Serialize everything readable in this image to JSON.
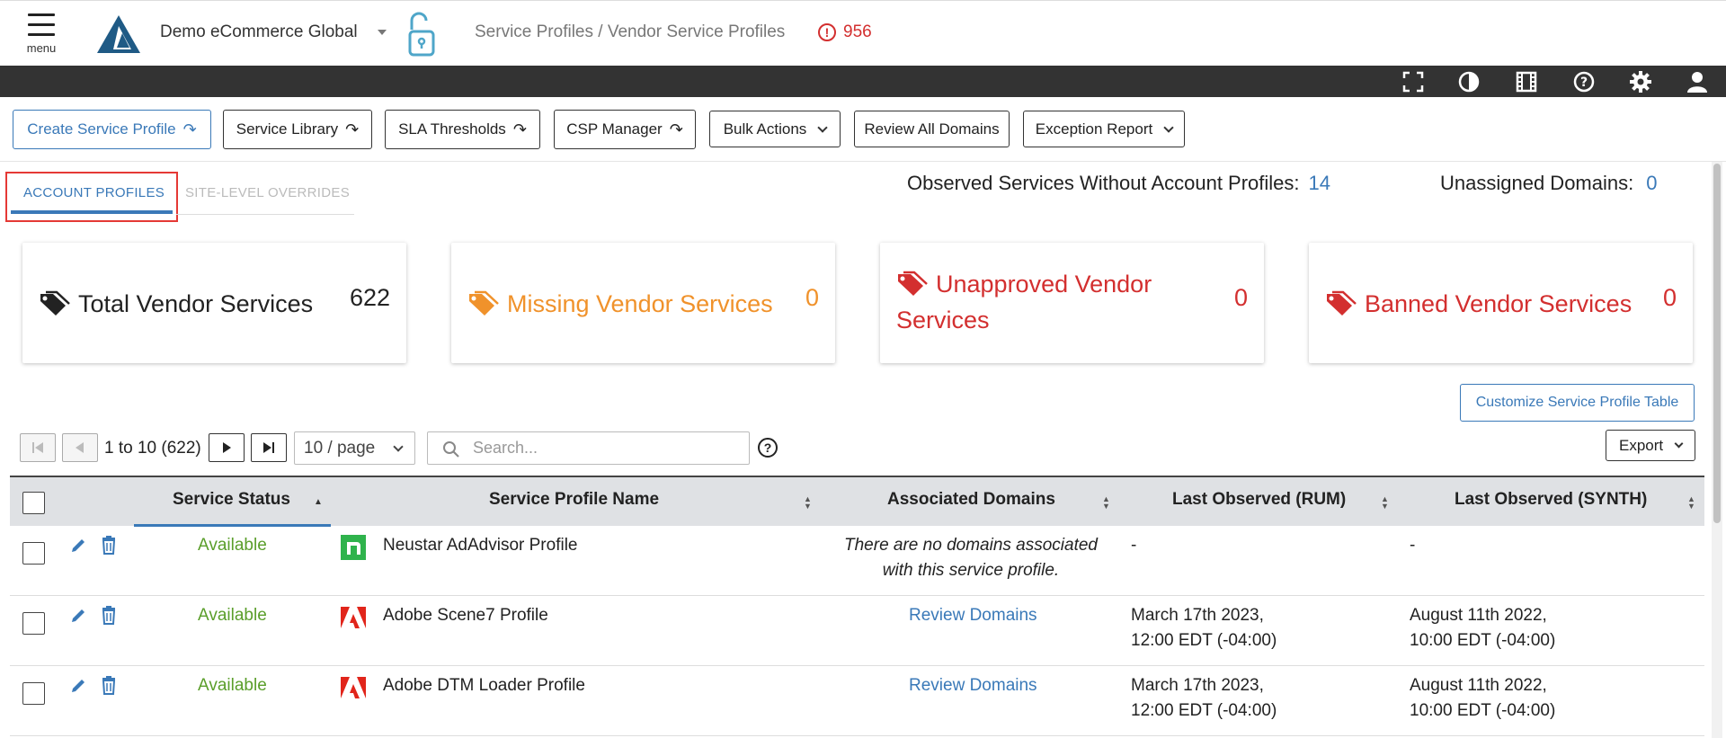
{
  "header": {
    "menu_label": "menu",
    "org_name": "Demo eCommerce Global",
    "breadcrumb": "Service Profiles / Vendor Service Profiles",
    "alert_count": "956"
  },
  "toolbar": {
    "create_service_profile": "Create Service Profile",
    "service_library": "Service Library",
    "sla_thresholds": "SLA Thresholds",
    "csp_manager": "CSP Manager",
    "bulk_actions": "Bulk Actions",
    "review_all_domains": "Review All Domains",
    "exception_report": "Exception Report"
  },
  "tabs": {
    "account_profiles": "ACCOUNT PROFILES",
    "site_level_overrides": "SITE-LEVEL OVERRIDES"
  },
  "summary": {
    "observed_label": "Observed Services Without Account Profiles:",
    "observed_value": "14",
    "unassigned_label": "Unassigned Domains:",
    "unassigned_value": "0"
  },
  "cards": {
    "total": {
      "label": "Total Vendor Services",
      "value": "622",
      "color": "#222222"
    },
    "missing": {
      "label": "Missing Vendor Services",
      "value": "0",
      "color": "#f0922b"
    },
    "unapproved_line1": "Unapproved Vendor",
    "unapproved_line2": "Services",
    "unapproved_value": "0",
    "unapproved_color": "#d32f2f",
    "banned": {
      "label": "Banned Vendor Services",
      "value": "0",
      "color": "#d32f2f"
    }
  },
  "customize_button": "Customize Service Profile Table",
  "pager": {
    "range_text": "1 to 10 (622)",
    "per_page": "10 / page",
    "search_placeholder": "Search...",
    "export_label": "Export"
  },
  "table": {
    "columns": {
      "status": "Service Status",
      "name": "Service Profile Name",
      "domains": "Associated Domains",
      "rum": "Last Observed (RUM)",
      "synth": "Last Observed (SYNTH)"
    },
    "rows": [
      {
        "status": "Available",
        "name": "Neustar AdAdvisor Profile",
        "logo": "neustar-logo",
        "domains_line1": "There are no domains associated",
        "domains_line2": "with this service profile.",
        "rum_line1": "-",
        "rum_line2": "",
        "synth_line1": "-",
        "synth_line2": ""
      },
      {
        "status": "Available",
        "name": "Adobe Scene7 Profile",
        "logo": "adobe-logo",
        "domains_link": "Review Domains",
        "rum_line1": "March 17th 2023,",
        "rum_line2": "12:00 EDT (-04:00)",
        "synth_line1": "August 11th 2022,",
        "synth_line2": "10:00 EDT (-04:00)"
      },
      {
        "status": "Available",
        "name": "Adobe DTM Loader Profile",
        "logo": "adobe-logo",
        "domains_link": "Review Domains",
        "rum_line1": "March 17th 2023,",
        "rum_line2": "12:00 EDT (-04:00)",
        "synth_line1": "August 11th 2022,",
        "synth_line2": "10:00 EDT (-04:00)"
      }
    ]
  },
  "colors": {
    "accent": "#3a79b8",
    "dark_bar": "#333333",
    "danger": "#d32f2f",
    "warning": "#f0922b",
    "success": "#5a9e2a"
  }
}
